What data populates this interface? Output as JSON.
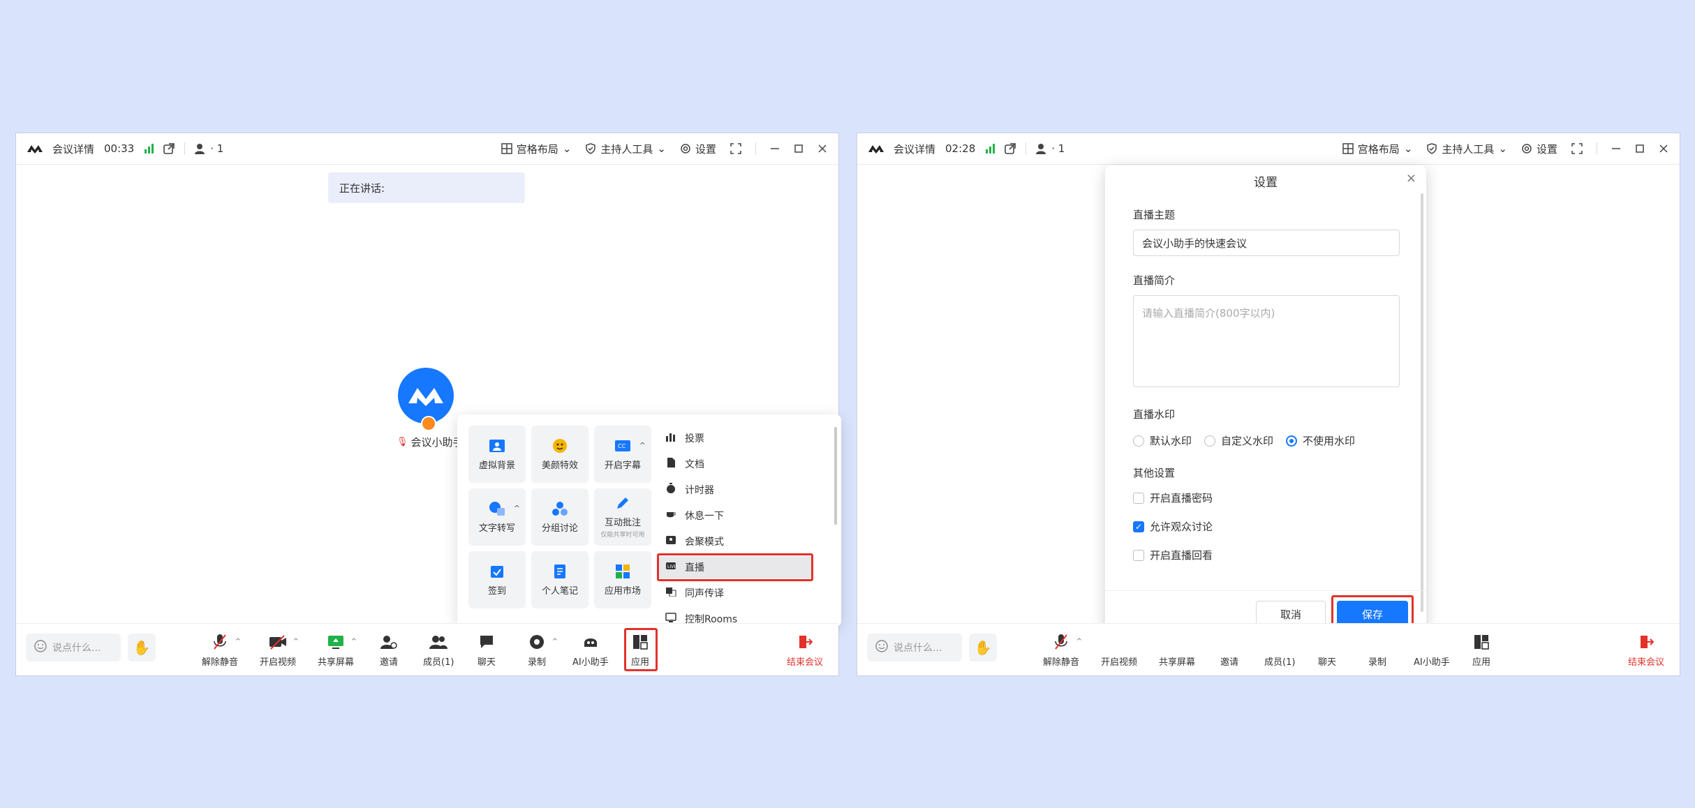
{
  "colors": {
    "accent": "#1677ff",
    "danger": "#e2322a",
    "bg": "#d9e4fc",
    "signal": "#20b24a"
  },
  "left": {
    "titlebar": {
      "details": "会议详情",
      "timer": "00:33",
      "participants": "· 1",
      "layout": "宫格布局",
      "host_tools": "主持人工具",
      "settings": "设置"
    },
    "speaking": "正在讲话:",
    "avatar_name": "会议小助手",
    "apps": {
      "tiles": [
        {
          "label": "虚拟背景",
          "icon": "virtual-background-icon"
        },
        {
          "label": "美颜特效",
          "icon": "beauty-icon"
        },
        {
          "label": "开启字幕",
          "icon": "captions-icon"
        },
        {
          "label": "文字转写",
          "icon": "transcribe-icon"
        },
        {
          "label": "分组讨论",
          "icon": "breakout-icon"
        },
        {
          "label": "互动批注",
          "sub": "仅能共享时可用",
          "icon": "annotate-icon"
        },
        {
          "label": "签到",
          "icon": "checkin-icon"
        },
        {
          "label": "个人笔记",
          "icon": "notes-icon"
        },
        {
          "label": "应用市场",
          "icon": "app-market-icon"
        }
      ],
      "list": [
        "投票",
        "文档",
        "计时器",
        "休息一下",
        "会聚模式",
        "直播",
        "同声传译",
        "控制Rooms"
      ]
    },
    "toolbar": {
      "chat_placeholder": "说点什么...",
      "mute": "解除静音",
      "video": "开启视频",
      "share": "共享屏幕",
      "invite": "邀请",
      "members": "成员(1)",
      "chat": "聊天",
      "record": "录制",
      "ai": "AI小助手",
      "apps": "应用",
      "end": "结束会议"
    }
  },
  "right": {
    "titlebar": {
      "details": "会议详情",
      "timer": "02:28",
      "participants": "· 1",
      "layout": "宫格布局",
      "host_tools": "主持人工具",
      "settings": "设置"
    },
    "dialog": {
      "title": "设置",
      "topic_label": "直播主题",
      "topic_value": "会议小助手的快速会议",
      "intro_label": "直播简介",
      "intro_placeholder": "请输入直播简介(800字以内)",
      "watermark_label": "直播水印",
      "watermark_options": [
        "默认水印",
        "自定义水印",
        "不使用水印"
      ],
      "watermark_selected": "不使用水印",
      "other_label": "其他设置",
      "checkboxes": [
        {
          "label": "开启直播密码",
          "checked": false
        },
        {
          "label": "允许观众讨论",
          "checked": true
        },
        {
          "label": "开启直播回看",
          "checked": false
        }
      ],
      "cancel": "取消",
      "save": "保存"
    },
    "toolbar": {
      "chat_placeholder": "说点什么...",
      "mute": "解除静音",
      "video": "开启视频",
      "share": "共享屏幕",
      "invite": "邀请",
      "members": "成员(1)",
      "chat": "聊天",
      "record": "录制",
      "ai": "AI小助手",
      "apps": "应用",
      "end": "结束会议"
    }
  }
}
